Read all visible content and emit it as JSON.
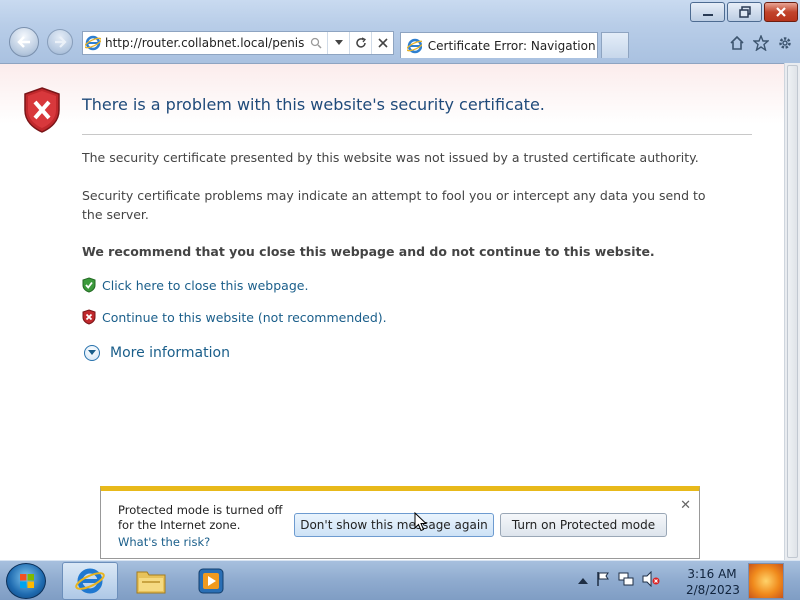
{
  "browser": {
    "address_url": "http://router.collabnet.local/penis.crt",
    "tab_title": "Certificate Error: Navigation ...",
    "caption_buttons": [
      "minimize-icon",
      "restore-icon",
      "close-icon"
    ],
    "toolbar_icons": [
      "home-icon",
      "star-icon",
      "gear-icon"
    ]
  },
  "page": {
    "heading": "There is a problem with this website's security certificate.",
    "paragraph1": "The security certificate presented by this website was not issued by a trusted certificate authority.",
    "paragraph2": "Security certificate problems may indicate an attempt to fool you or intercept any data you send to the server.",
    "recommendation": "We recommend that you close this webpage and do not continue to this website.",
    "link_close": "Click here to close this webpage.",
    "link_continue": "Continue to this website (not recommended).",
    "more_info": "More information"
  },
  "notification": {
    "message": "Protected mode is turned off for the Internet zone.",
    "risk_link": "What's the risk?",
    "button_dont_show": "Don't show this message again",
    "button_turn_on": "Turn on Protected mode"
  },
  "taskbar": {
    "time": "3:16 AM",
    "date": "2/8/2023",
    "pinned": [
      "internet-explorer-icon",
      "folder-icon",
      "media-player-icon"
    ],
    "tray_icons": [
      "show-hidden-icon",
      "flag-icon",
      "network-icon",
      "volume-muted-icon"
    ]
  },
  "colors": {
    "heading": "#1f4a7a",
    "link": "#1a5e8a",
    "notify_accent": "#e8b91a",
    "shield_red": "#c0282c"
  }
}
